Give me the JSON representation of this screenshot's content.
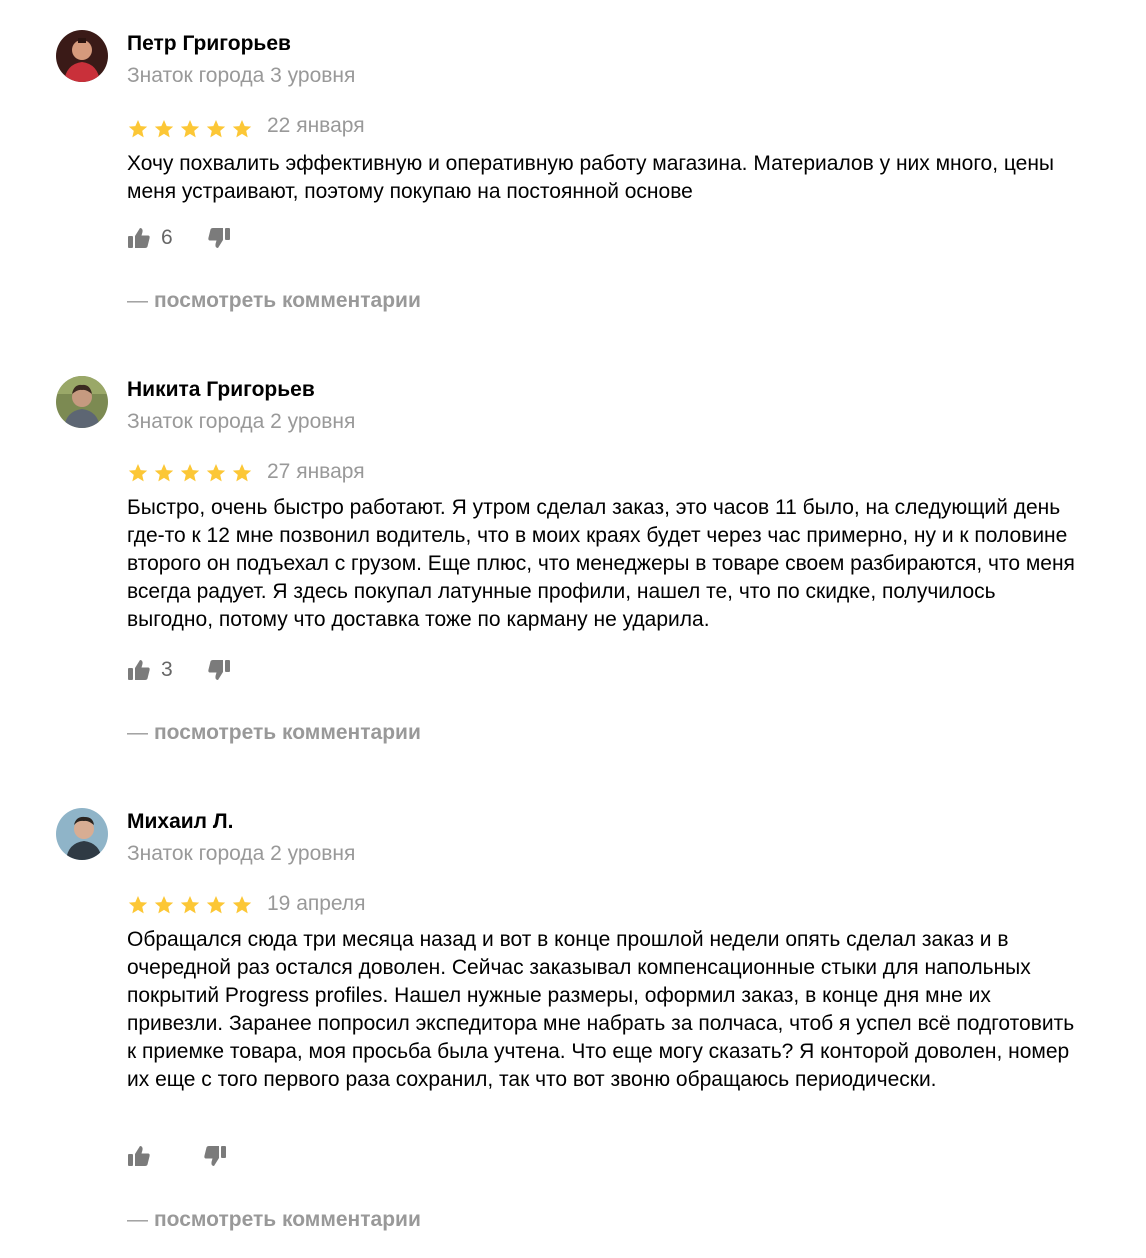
{
  "reviews": [
    {
      "author": "Петр Григорьев",
      "level": "Знаток города 3 уровня",
      "rating": 5,
      "date": "22 января",
      "text": "Хочу похвалить эффективную и оперативную работу магазина. Материалов у них много, цены меня устраивают, поэтому покупаю на постоянной основе",
      "likes": "6",
      "comments_label": "посмотреть комментарии",
      "avatar_colors": {
        "bg": "#3a1a17",
        "face": "#d59a7c",
        "shirt": "#c9303a"
      }
    },
    {
      "author": "Никита Григорьев",
      "level": "Знаток города 2 уровня",
      "rating": 5,
      "date": "27 января",
      "text": "Быстро, очень быстро работают. Я утром сделал заказ, это часов 11 было, на следующий день где-то к 12 мне позвонил водитель, что в моих краях будет через час примерно, ну и к половине второго он подъехал с грузом. Еще плюс, что менеджеры в товаре своем разбираются, что меня всегда радует. Я здесь покупал латунные профили, нашел те, что по скидке, получилось выгодно, потому что доставка тоже по карману не ударила.",
      "likes": "3",
      "comments_label": "посмотреть комментарии",
      "avatar_colors": {
        "bg": "#7c8a52",
        "face": "#c69a80",
        "shirt": "#5d6673"
      }
    },
    {
      "author": "Михаил Л.",
      "level": "Знаток города 2 уровня",
      "rating": 5,
      "date": "19 апреля",
      "text": "Обращался сюда три месяца назад и вот в конце прошлой недели опять сделал заказ и в очередной раз остался доволен. Сейчас заказывал компенсационные стыки для напольных покрытий Progress profiles. Нашел нужные размеры, оформил заказ, в конце дня мне их привезли. Заранее попросил экспедитора мне набрать за полчаса, чтоб я успел всё подготовить к приемке товара, моя просьба была учтена. Что еще могу сказать? Я конторой доволен, номер их еще с того первого раза сохранил, так что вот звоню обращаюсь периодически.",
      "likes": "",
      "comments_label": "посмотреть комментарии",
      "avatar_colors": {
        "bg": "#8fb4c8",
        "face": "#d8ad93",
        "shirt": "#2f3a44"
      }
    }
  ],
  "colors": {
    "star": "#fcc736",
    "muted_text": "#999999",
    "vote_icon": "#7b7b7b"
  },
  "icons": {
    "like": "thumbs-up-icon",
    "dislike": "thumbs-down-icon",
    "star": "star-icon"
  }
}
